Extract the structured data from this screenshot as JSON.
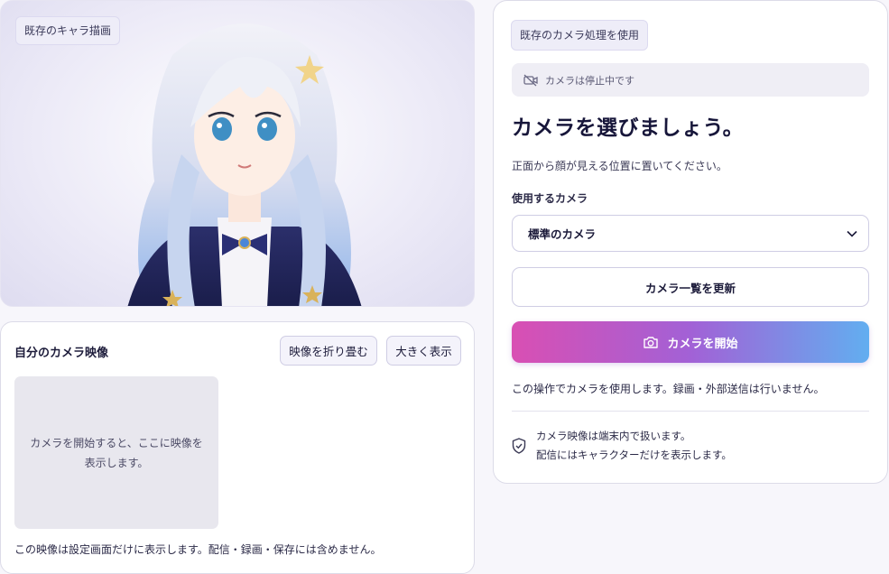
{
  "character_panel": {
    "badge": "既存のキャラ描画"
  },
  "camera_preview": {
    "title": "自分のカメラ映像",
    "collapse_button": "映像を折り畳む",
    "enlarge_button": "大きく表示",
    "placeholder": "カメラを開始すると、ここに映像を表示します。",
    "note": "この映像は設定画面だけに表示します。配信・録画・保存には含めません。"
  },
  "camera_setup": {
    "mode_badge": "既存のカメラ処理を使用",
    "status_icon": "camera-off-icon",
    "status_text": "カメラは停止中です",
    "headline": "カメラを選びましょう。",
    "subtitle": "正面から顔が見える位置に置いてください。",
    "select_label": "使用するカメラ",
    "selected_camera": "標準のカメラ",
    "refresh_button": "カメラ一覧を更新",
    "start_button": "カメラを開始",
    "start_icon": "camera-icon",
    "usage_note": "この操作でカメラを使用します。録画・外部送信は行いません。",
    "privacy_icon": "shield-check-icon",
    "privacy_line1": "カメラ映像は端末内で扱います。",
    "privacy_line2": "配信にはキャラクターだけを表示します。"
  },
  "colors": {
    "accent_gradient_start": "#d94fb3",
    "accent_gradient_end": "#62aef0",
    "text_dark": "#1c1b3a"
  }
}
